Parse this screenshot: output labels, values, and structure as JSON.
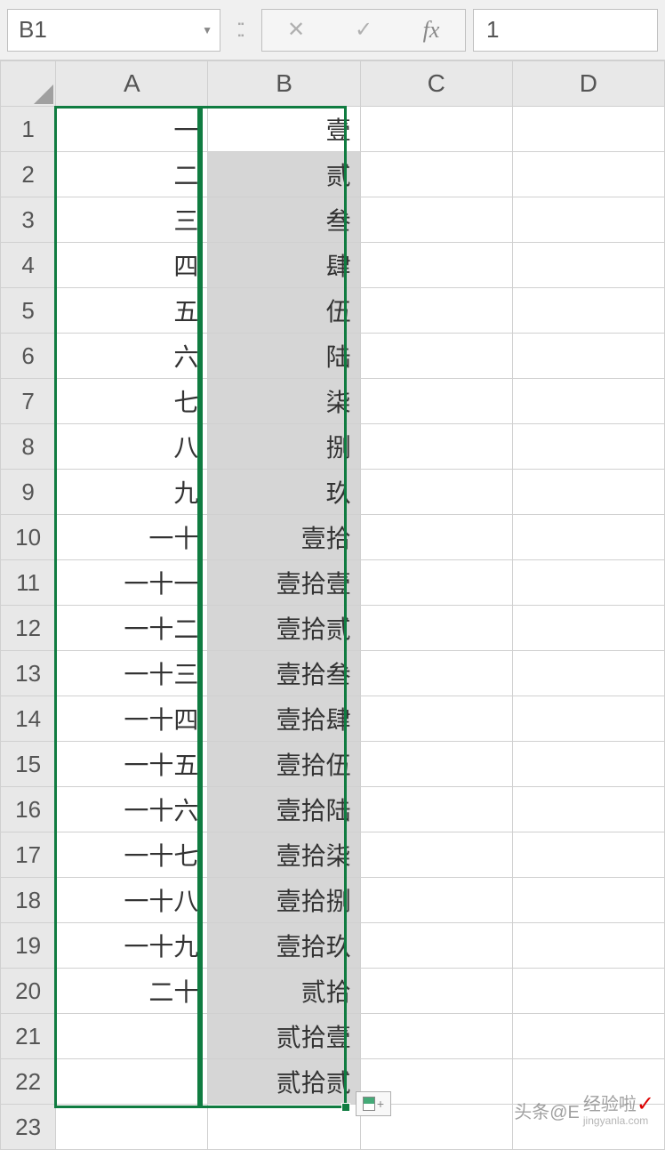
{
  "formula_bar": {
    "name_box": "B1",
    "cancel": "✕",
    "enter": "✓",
    "fx": "fx",
    "value": "1"
  },
  "columns": [
    "A",
    "B",
    "C",
    "D"
  ],
  "row_numbers": [
    "1",
    "2",
    "3",
    "4",
    "5",
    "6",
    "7",
    "8",
    "9",
    "10",
    "11",
    "12",
    "13",
    "14",
    "15",
    "16",
    "17",
    "18",
    "19",
    "20",
    "21",
    "22",
    "23"
  ],
  "data_a": [
    "一",
    "二",
    "三",
    "四",
    "五",
    "六",
    "七",
    "八",
    "九",
    "一十",
    "一十一",
    "一十二",
    "一十三",
    "一十四",
    "一十五",
    "一十六",
    "一十七",
    "一十八",
    "一十九",
    "二十",
    "",
    "",
    ""
  ],
  "data_b": [
    "壹",
    "贰",
    "叁",
    "肆",
    "伍",
    "陆",
    "柒",
    "捌",
    "玖",
    "壹拾",
    "壹拾壹",
    "壹拾贰",
    "壹拾叁",
    "壹拾肆",
    "壹拾伍",
    "壹拾陆",
    "壹拾柒",
    "壹拾捌",
    "壹拾玖",
    "贰拾",
    "贰拾壹",
    "贰拾贰",
    ""
  ],
  "watermark": {
    "prefix": "头条@E",
    "suffix": "经验啦",
    "domain": "jingyanla.com"
  }
}
